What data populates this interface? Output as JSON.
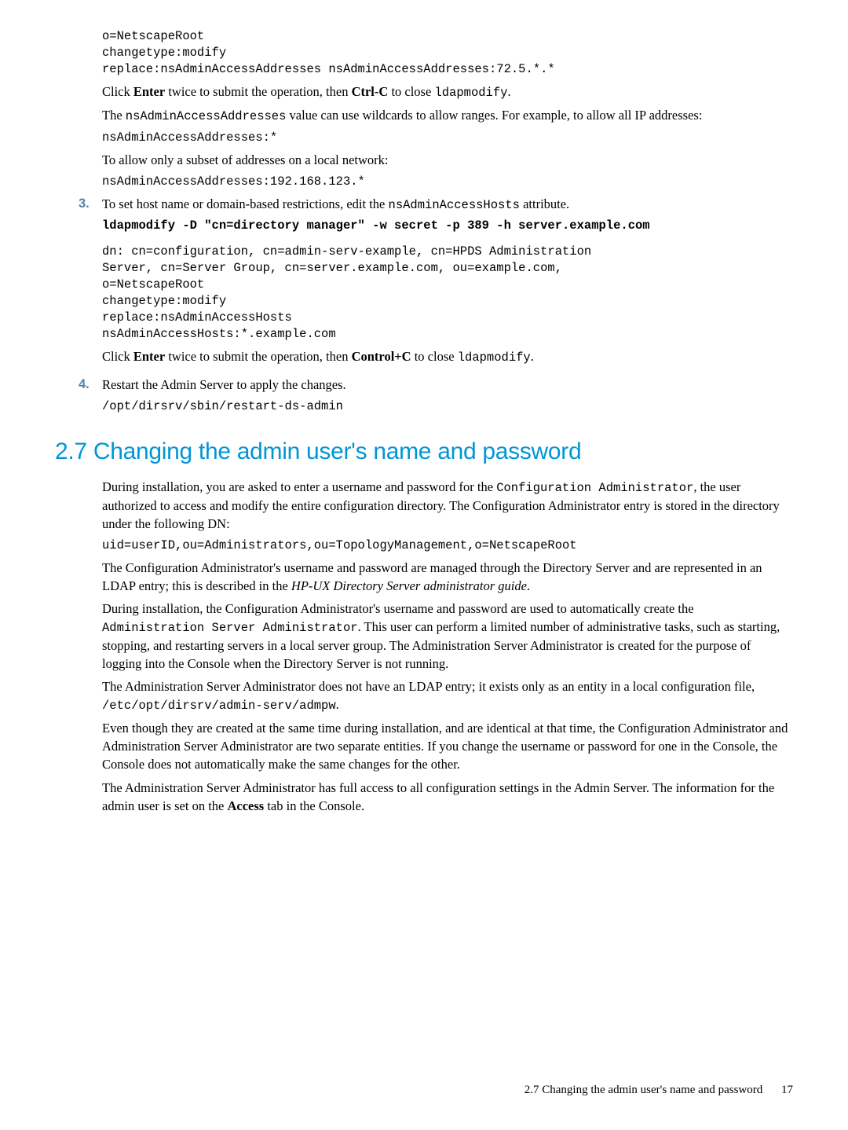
{
  "code1": "o=NetscapeRoot\nchangetype:modify\nreplace:nsAdminAccessAddresses nsAdminAccessAddresses:72.5.*.*",
  "para1a": "Click ",
  "para1b": "Enter",
  "para1c": " twice to submit the operation, then ",
  "para1d": "Ctrl-C",
  "para1e": " to close ",
  "para1f": "ldapmodify",
  "para1g": ".",
  "para2a": "The ",
  "para2b": "nsAdminAccessAddresses",
  "para2c": " value can use wildcards to allow ranges. For example, to allow all IP addresses:",
  "code2": "nsAdminAccessAddresses:*",
  "para3": "To allow only a subset of addresses on a local network:",
  "code3": "nsAdminAccessAddresses:192.168.123.*",
  "step3num": "3.",
  "step3a": "To set host name or domain-based restrictions, edit the ",
  "step3b": "nsAdminAccessHosts",
  "step3c": " attribute.",
  "code4bold": "ldapmodify -D \"cn=directory manager\" -w secret -p 389 -h server.example.com",
  "code5": "dn: cn=configuration, cn=admin-serv-example, cn=HPDS Administration\nServer, cn=Server Group, cn=server.example.com, ou=example.com,\no=NetscapeRoot\nchangetype:modify\nreplace:nsAdminAccessHosts\nnsAdminAccessHosts:*.example.com",
  "para4a": "Click ",
  "para4b": "Enter",
  "para4c": " twice to submit the operation, then ",
  "para4d": "Control+C",
  "para4e": " to close ",
  "para4f": "ldapmodify",
  "para4g": ".",
  "step4num": "4.",
  "step4": "Restart the Admin Server to apply the changes.",
  "code6": "/opt/dirsrv/sbin/restart-ds-admin",
  "heading": "2.7 Changing the admin user's name and password",
  "body1a": "During installation, you are asked to enter a username and password for the ",
  "body1b": "Configuration Administrator",
  "body1c": ", the user authorized to access and modify the entire configuration directory. The Configuration Administrator entry is stored in the directory under the following DN:",
  "code7": "uid=userID,ou=Administrators,ou=TopologyManagement,o=NetscapeRoot",
  "body2a": "The Configuration Administrator's username and password are managed through the Directory Server and are represented in an LDAP entry; this is described in the ",
  "body2b": "HP-UX Directory Server administrator guide",
  "body2c": ".",
  "body3a": "During installation, the Configuration Administrator's username and password are used to automatically create the ",
  "body3b": "Administration Server Administrator",
  "body3c": ". This user can perform a limited number of administrative tasks, such as starting, stopping, and restarting servers in a local server group. The Administration Server Administrator is created for the purpose of logging into the Console when the Directory Server is not running.",
  "body4a": "The Administration Server Administrator does not have an LDAP entry; it exists only as an entity in a local configuration file, ",
  "body4b": "/etc/opt/dirsrv/admin-serv/admpw",
  "body4c": ".",
  "body5": "Even though they are created at the same time during installation, and are identical at that time, the Configuration Administrator and Administration Server Administrator are two separate entities. If you change the username or password for one in the Console, the Console does not automatically make the same changes for the other.",
  "body6a": "The Administration Server Administrator has full access to all configuration settings in the Admin Server. The information for the admin user is set on the ",
  "body6b": "Access",
  "body6c": " tab in the Console.",
  "footer_text": "2.7 Changing the admin user's name and password",
  "footer_page": "17"
}
